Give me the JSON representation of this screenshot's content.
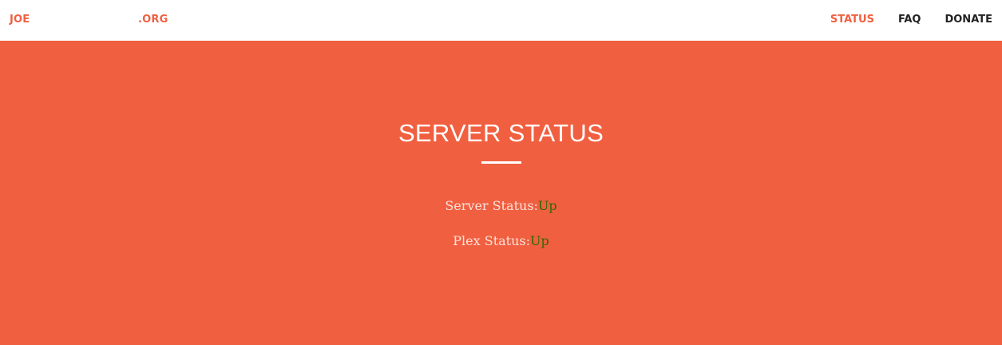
{
  "colors": {
    "accent": "#f05f40",
    "nav_background": "#ffffff",
    "nav_text": "#222222",
    "status_up": "#2d6a00",
    "label_text": "#fbe3dc"
  },
  "navbar": {
    "brand_left": "JOE",
    "brand_right": ".ORG",
    "links": [
      {
        "label": "STATUS",
        "active": true
      },
      {
        "label": "FAQ",
        "active": false
      },
      {
        "label": "DONATE",
        "active": false
      }
    ]
  },
  "hero": {
    "title": "SERVER STATUS",
    "statuses": [
      {
        "label": "Server Status:",
        "value": "Up"
      },
      {
        "label": "Plex Status:",
        "value": "Up"
      }
    ]
  }
}
